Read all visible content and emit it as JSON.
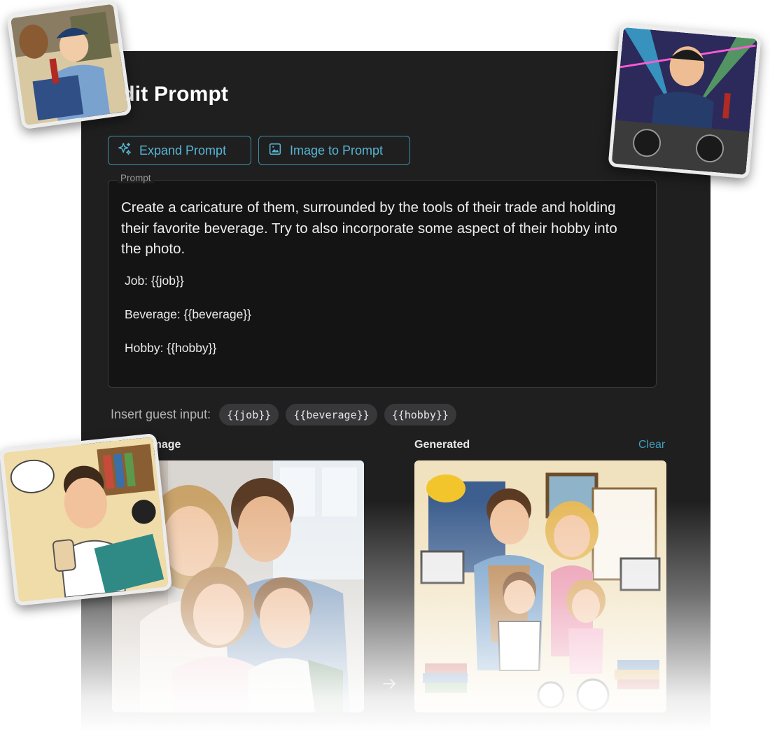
{
  "dialog": {
    "title": "Edit Prompt",
    "expand_label": "Expand Prompt",
    "image_to_prompt_label": "Image to Prompt"
  },
  "prompt": {
    "label": "Prompt",
    "main_text": "Create a caricature of them, surrounded by the tools of their trade and holding their favorite beverage. Try to also incorporate some aspect of their hobby into the photo.",
    "line_job": "Job: {{job}}",
    "line_beverage": "Beverage: {{beverage}}",
    "line_hobby": "Hobby: {{hobby}}"
  },
  "insert": {
    "label": "Insert guest input:",
    "chips": [
      "{{job}}",
      "{{beverage}}",
      "{{hobby}}"
    ]
  },
  "images": {
    "target_label": "Target Image",
    "generated_label": "Generated",
    "clear_label": "Clear"
  },
  "icons": {
    "expand": "sparkle-icon",
    "image_to_prompt": "image-icon",
    "arrow": "arrow-right-icon"
  },
  "colors": {
    "panel_bg": "#1f1f20",
    "accent": "#56b6d4",
    "clear_link": "#3f9fbe"
  }
}
